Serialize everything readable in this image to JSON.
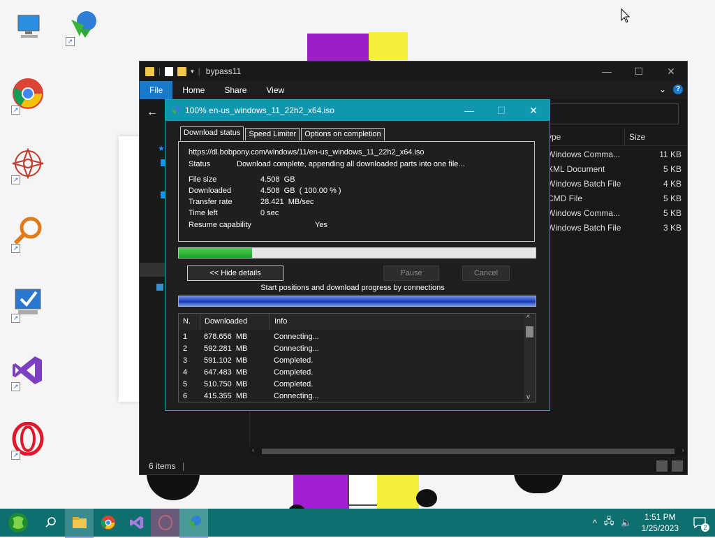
{
  "desktop": {
    "icons": [
      {
        "name": "this-pc-icon"
      },
      {
        "name": "internet-download-manager-icon"
      },
      {
        "name": "chrome-icon"
      },
      {
        "name": "mandala-app-icon"
      },
      {
        "name": "magnifier-app-icon"
      },
      {
        "name": "monitor-check-icon"
      },
      {
        "name": "visual-studio-icon"
      },
      {
        "name": "opera-icon"
      }
    ]
  },
  "explorer": {
    "title": "bypass11",
    "ribbon_tabs": [
      "File",
      "Home",
      "Share",
      "View"
    ],
    "columns": {
      "type": "ype",
      "size": "Size"
    },
    "files": [
      {
        "type": "Windows Comma...",
        "size": "11 KB"
      },
      {
        "type": "XML Document",
        "size": "5 KB"
      },
      {
        "type": "Windows Batch File",
        "size": "4 KB"
      },
      {
        "type": "CMD File",
        "size": "5 KB"
      },
      {
        "type": "Windows Comma...",
        "size": "5 KB"
      },
      {
        "type": "Windows Batch File",
        "size": "3 KB"
      }
    ],
    "status": "6 items"
  },
  "idm": {
    "title": "100% en-us_windows_11_22h2_x64.iso",
    "tabs": [
      "Download status",
      "Speed Limiter",
      "Options on completion"
    ],
    "url": "https://dl.bobpony.com/windows/11/en-us_windows_11_22h2_x64.iso",
    "status_label": "Status",
    "status_value": "Download complete, appending all downloaded parts into one file...",
    "file_size_label": "File size",
    "file_size_value": "4.508  GB",
    "downloaded_label": "Downloaded",
    "downloaded_value": "4.508  GB  ( 100.00 % )",
    "transfer_rate_label": "Transfer rate",
    "transfer_rate_value": "28.421  MB/sec",
    "time_left_label": "Time left",
    "time_left_value": "0 sec",
    "resume_label": "Resume capability",
    "resume_value": "Yes",
    "progress_fraction": 0.205,
    "hide_details_label": "<< Hide details",
    "pause_label": "Pause",
    "cancel_label": "Cancel",
    "connections_caption": "Start positions and download progress by connections",
    "table": {
      "headers": [
        "N.",
        "Downloaded",
        "Info"
      ],
      "rows": [
        {
          "n": "1",
          "downloaded": "678.656  MB",
          "info": "Connecting..."
        },
        {
          "n": "2",
          "downloaded": "592.281  MB",
          "info": "Connecting..."
        },
        {
          "n": "3",
          "downloaded": "591.102  MB",
          "info": "Completed."
        },
        {
          "n": "4",
          "downloaded": "647.483  MB",
          "info": "Completed."
        },
        {
          "n": "5",
          "downloaded": "510.750  MB",
          "info": "Completed."
        },
        {
          "n": "6",
          "downloaded": "415.355  MB",
          "info": "Connecting..."
        }
      ]
    }
  },
  "taskbar": {
    "apps": [
      "start-icon",
      "search-icon",
      "file-explorer-icon",
      "chrome-icon",
      "visual-studio-icon",
      "opera-icon",
      "internet-download-manager-icon"
    ],
    "time": "1:51 PM",
    "date": "1/25/2023",
    "notification_count": "2"
  },
  "colors": {
    "accent": "#0f97b0",
    "taskbar": "#0f6e6e",
    "progress": "#17a31f"
  }
}
